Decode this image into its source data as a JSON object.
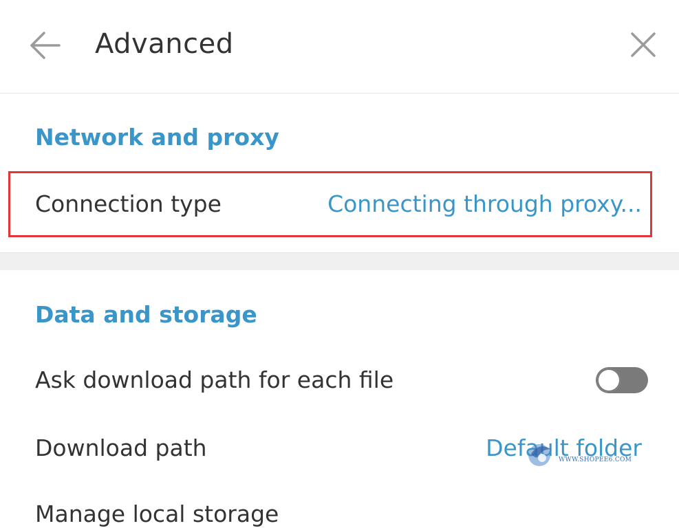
{
  "header": {
    "title": "Advanced",
    "back_icon": "arrow-left-icon",
    "close_icon": "close-icon"
  },
  "network": {
    "section_title": "Network and proxy",
    "connection_type_label": "Connection type",
    "connection_type_value": "Connecting through proxy..."
  },
  "storage": {
    "section_title": "Data and storage",
    "ask_download_label": "Ask download path for each file",
    "ask_download_enabled": false,
    "download_path_label": "Download path",
    "download_path_value": "Default folder",
    "manage_storage_label": "Manage local storage"
  },
  "watermark": {
    "text": "WWW.SHOPEE6.COM"
  },
  "colors": {
    "accent": "#3a95c9",
    "text": "#333333",
    "highlight_border": "#e2363b",
    "toggle_off": "#7a7a7a"
  }
}
